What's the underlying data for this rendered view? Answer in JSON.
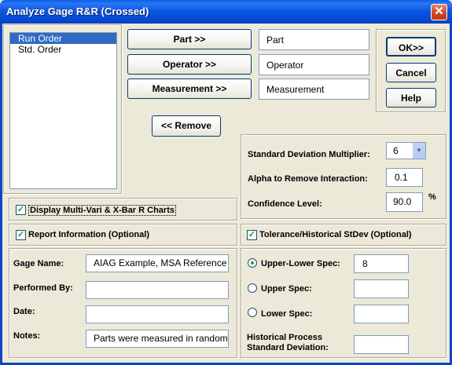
{
  "window": {
    "title": "Analyze Gage R&R (Crossed)"
  },
  "list": {
    "items": [
      "Run Order",
      "Std. Order"
    ],
    "selected_index": 0
  },
  "buttons": {
    "part": "Part >>",
    "operator": "Operator >>",
    "measurement": "Measurement >>",
    "remove": "<< Remove",
    "ok": "OK>>",
    "cancel": "Cancel",
    "help": "Help"
  },
  "assign": {
    "part": "Part",
    "operator": "Operator",
    "measurement": "Measurement"
  },
  "options": {
    "sd_multiplier_label": "Standard Deviation Multiplier:",
    "sd_multiplier_value": "6",
    "alpha_label": "Alpha to Remove Interaction:",
    "alpha_value": "0.1",
    "confidence_label": "Confidence Level:",
    "confidence_value": "90.0",
    "confidence_unit": "%"
  },
  "checks": {
    "multivari_label": "Display Multi-Vari & X-Bar R Charts",
    "multivari_checked": true,
    "report_label": "Report Information (Optional)",
    "report_checked": true,
    "tolerance_label": "Tolerance/Historical StDev (Optional)",
    "tolerance_checked": true
  },
  "report": {
    "gage_label": "Gage Name:",
    "gage_value": "AIAG Example, MSA Reference",
    "performed_label": "Performed By:",
    "performed_value": "",
    "date_label": "Date:",
    "date_value": "",
    "notes_label": "Notes:",
    "notes_value": "Parts were measured in random"
  },
  "tolerance": {
    "upper_lower_label": "Upper-Lower Spec:",
    "upper_lower_value": "8",
    "upper_label": "Upper Spec:",
    "upper_value": "",
    "lower_label": "Lower Spec:",
    "lower_value": "",
    "historical_label_line1": "Historical Process",
    "historical_label_line2": "Standard Deviation:",
    "historical_value": "",
    "selected": "upper_lower"
  },
  "colors": {
    "title_bar": "#0a5ee8",
    "face": "#ece9d8",
    "selection": "#316ac5"
  }
}
